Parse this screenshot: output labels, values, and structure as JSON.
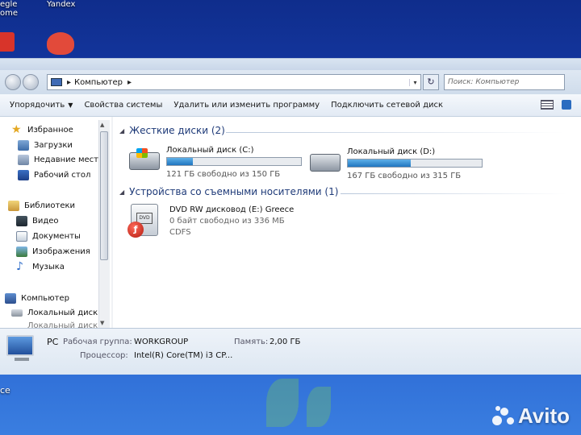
{
  "desktop": {
    "top_left_text_1": "egle",
    "top_left_text_2": "ome",
    "top_text_2": "Yandex",
    "bottom_left_text": "ce",
    "watermark": "Avito"
  },
  "window": {
    "address_root": "Компьютер",
    "search_placeholder": "Поиск: Компьютер"
  },
  "toolbar": {
    "organize": "Упорядочить",
    "system_properties": "Свойства системы",
    "uninstall": "Удалить или изменить программу",
    "map_drive": "Подключить сетевой диск"
  },
  "nav": {
    "favorites": "Избранное",
    "downloads": "Загрузки",
    "recent": "Недавние места",
    "desktop": "Рабочий стол",
    "libraries": "Библиотеки",
    "video": "Видео",
    "documents": "Документы",
    "images": "Изображения",
    "music": "Музыка",
    "computer": "Компьютер",
    "local_disk": "Локальный диск",
    "local_disk_2": "Локальный диск"
  },
  "main": {
    "hard_disks_header": "Жесткие диски (2)",
    "removable_header": "Устройства со съемными носителями (1)",
    "drives": [
      {
        "name": "Локальный диск (C:)",
        "free": "121 ГБ свободно из 150 ГБ",
        "used_fraction": 0.19
      },
      {
        "name": "Локальный диск (D:)",
        "free": "167 ГБ свободно из 315 ГБ",
        "used_fraction": 0.47
      }
    ],
    "dvd": {
      "name": "DVD RW дисковод (E:) Greece",
      "free": "0 байт свободно из 336 МБ",
      "fs": "CDFS",
      "label": "DVD"
    }
  },
  "details": {
    "name": "PC",
    "workgroup_label": "Рабочая группа:",
    "workgroup_value": "WORKGROUP",
    "memory_label": "Память:",
    "memory_value": "2,00 ГБ",
    "cpu_label": "Процессор:",
    "cpu_value": "Intel(R) Core(TM) i3 CP..."
  },
  "colors": {
    "progress_fill": "#1f75c0",
    "desktop_blue": "#1a43b8"
  }
}
